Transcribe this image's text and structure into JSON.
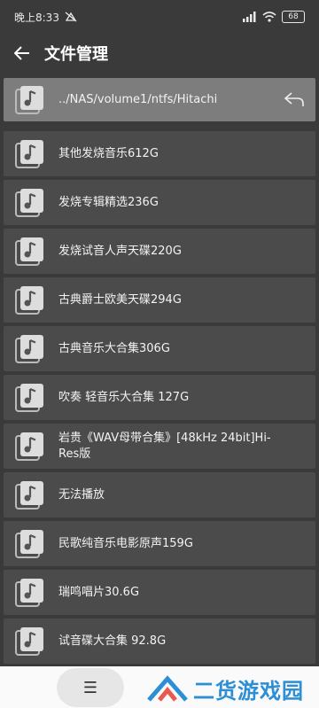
{
  "status_bar": {
    "time": "晚上8:33",
    "battery": "68"
  },
  "header": {
    "title": "文件管理"
  },
  "current_path": "../NAS/volume1/ntfs/Hitachi",
  "folders": [
    "其他发烧音乐612G",
    "发烧专辑精选236G",
    "发烧试音人声天碟220G",
    "古典爵士欧美天碟294G",
    "古典音乐大合集306G",
    "吹奏 轻音乐大合集 127G",
    "岩贵《WAV母带合集》[48kHz 24bit]Hi-Res版",
    "无法播放",
    "民歌纯音乐电影原声159G",
    "瑞鸣唱片30.6G",
    "试音碟大合集 92.8G"
  ],
  "bottom": {
    "menu_glyph": "☰"
  },
  "watermark": {
    "text": "二货游戏园"
  },
  "colors": {
    "background": "#3a3a3a",
    "item": "#4b4b4b",
    "current_item": "#7d7d7d",
    "watermark": "#2c8fd6"
  }
}
